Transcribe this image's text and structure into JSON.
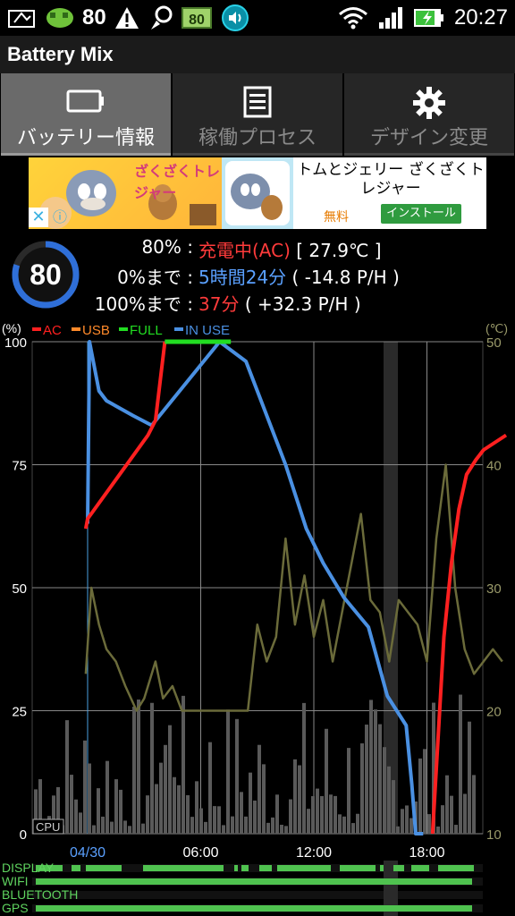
{
  "status_bar": {
    "battery_percent": "80",
    "time": "20:27",
    "icons": [
      "notification-icon",
      "app-icon",
      "warning-icon",
      "sync-icon",
      "battery-app-icon",
      "volume-icon",
      "wifi-icon",
      "signal-icon",
      "battery-charging-icon"
    ],
    "battery_app_icon_text": "80"
  },
  "app": {
    "title": "Battery Mix"
  },
  "tabs": [
    {
      "label": "バッテリー情報",
      "icon": "battery-icon",
      "active": true
    },
    {
      "label": "稼働プロセス",
      "icon": "list-icon",
      "active": false
    },
    {
      "label": "デザイン変更",
      "icon": "gear-icon",
      "active": false
    }
  ],
  "ad": {
    "banner_text": "ざくざくトレジャー",
    "text": "トムとジェリー ざくざくトレジャー",
    "free": "無料",
    "install": "インストール",
    "close": "✕",
    "info": "ⓘ"
  },
  "battery_info": {
    "gauge_value": "80",
    "gauge_fraction": 0.8,
    "row1": {
      "label": "80% :",
      "status": "充電中(AC)",
      "temp": "[ 27.9℃ ]"
    },
    "row2": {
      "label": "0%まで :",
      "time": "5時間24分",
      "rate": "( -14.8 P/H )"
    },
    "row3": {
      "label": "100%まで :",
      "time": "37分",
      "rate": "( +32.3 P/H )"
    }
  },
  "chart_data": {
    "type": "line",
    "left_unit": "(%)",
    "right_unit": "(℃)",
    "legend": [
      {
        "label": "AC",
        "color": "#ff2020"
      },
      {
        "label": "USB",
        "color": "#ff8a2a"
      },
      {
        "label": "FULL",
        "color": "#22dd22"
      },
      {
        "label": "IN USE",
        "color": "#4a90e2"
      }
    ],
    "y_left_ticks": [
      "100",
      "75",
      "50",
      "25",
      "0"
    ],
    "y_right_ticks": [
      "50",
      "40",
      "30",
      "20",
      "10"
    ],
    "ylim_left": [
      0,
      100
    ],
    "ylim_right": [
      10,
      50
    ],
    "x_ticks": [
      "04/30",
      "06:00",
      "12:00",
      "18:00"
    ],
    "cpu_label": "CPU",
    "grid": true,
    "series": [
      {
        "name": "AC",
        "x_hours": [
          -0.1,
          0.0,
          3.2,
          3.6,
          4.1,
          18.3,
          18.9,
          19.3,
          19.7,
          20.1,
          20.6,
          21.0,
          21.4,
          21.8,
          22.2
        ],
        "values": [
          62,
          64,
          81,
          84,
          100,
          0,
          40,
          55,
          66,
          73,
          76,
          78,
          79,
          80,
          81
        ]
      },
      {
        "name": "IN USE",
        "x_hours": [
          0.0,
          0.1,
          0.6,
          1.0,
          2.4,
          3.4,
          7.0,
          8.4,
          9.2,
          10.5,
          11.6,
          12.5,
          13.6,
          14.9,
          15.9,
          16.9,
          17.2,
          17.4,
          17.8
        ],
        "values": [
          63,
          100,
          90,
          88,
          85,
          83,
          100,
          96,
          88,
          75,
          62,
          55,
          48,
          42,
          28,
          22,
          10,
          0,
          0
        ]
      },
      {
        "name": "FULL",
        "x_hours": [
          4.1,
          7.6
        ],
        "values": [
          100,
          100
        ]
      },
      {
        "name": "temperature",
        "x_hours": [
          -0.1,
          0.2,
          0.6,
          1.0,
          1.5,
          2.0,
          2.6,
          3.0,
          3.6,
          4.0,
          4.5,
          5.0,
          5.5,
          6.0,
          7.0,
          8.5,
          9.0,
          9.5,
          10.0,
          10.5,
          11.0,
          11.5,
          12.0,
          12.5,
          13.0,
          13.5,
          14.0,
          14.5,
          15.0,
          15.5,
          16.0,
          16.5,
          17.0,
          17.5,
          18.0,
          18.5,
          19.0,
          19.5,
          20.0,
          20.5,
          21.0,
          21.5,
          22.0
        ],
        "values": [
          23,
          30,
          27,
          25,
          24,
          22,
          20,
          21,
          24,
          21,
          22,
          20,
          20,
          20,
          20,
          20,
          27,
          24,
          26,
          34,
          27,
          31,
          26,
          29,
          24,
          28,
          32,
          36,
          29,
          28,
          24,
          29,
          28,
          27,
          24,
          34,
          40,
          30,
          25,
          23,
          24,
          25,
          24
        ]
      }
    ]
  },
  "timeline": {
    "rows": [
      {
        "label": "DISPLAY"
      },
      {
        "label": "WIFI"
      },
      {
        "label": "BLUETOOTH"
      },
      {
        "label": "GPS"
      }
    ]
  }
}
